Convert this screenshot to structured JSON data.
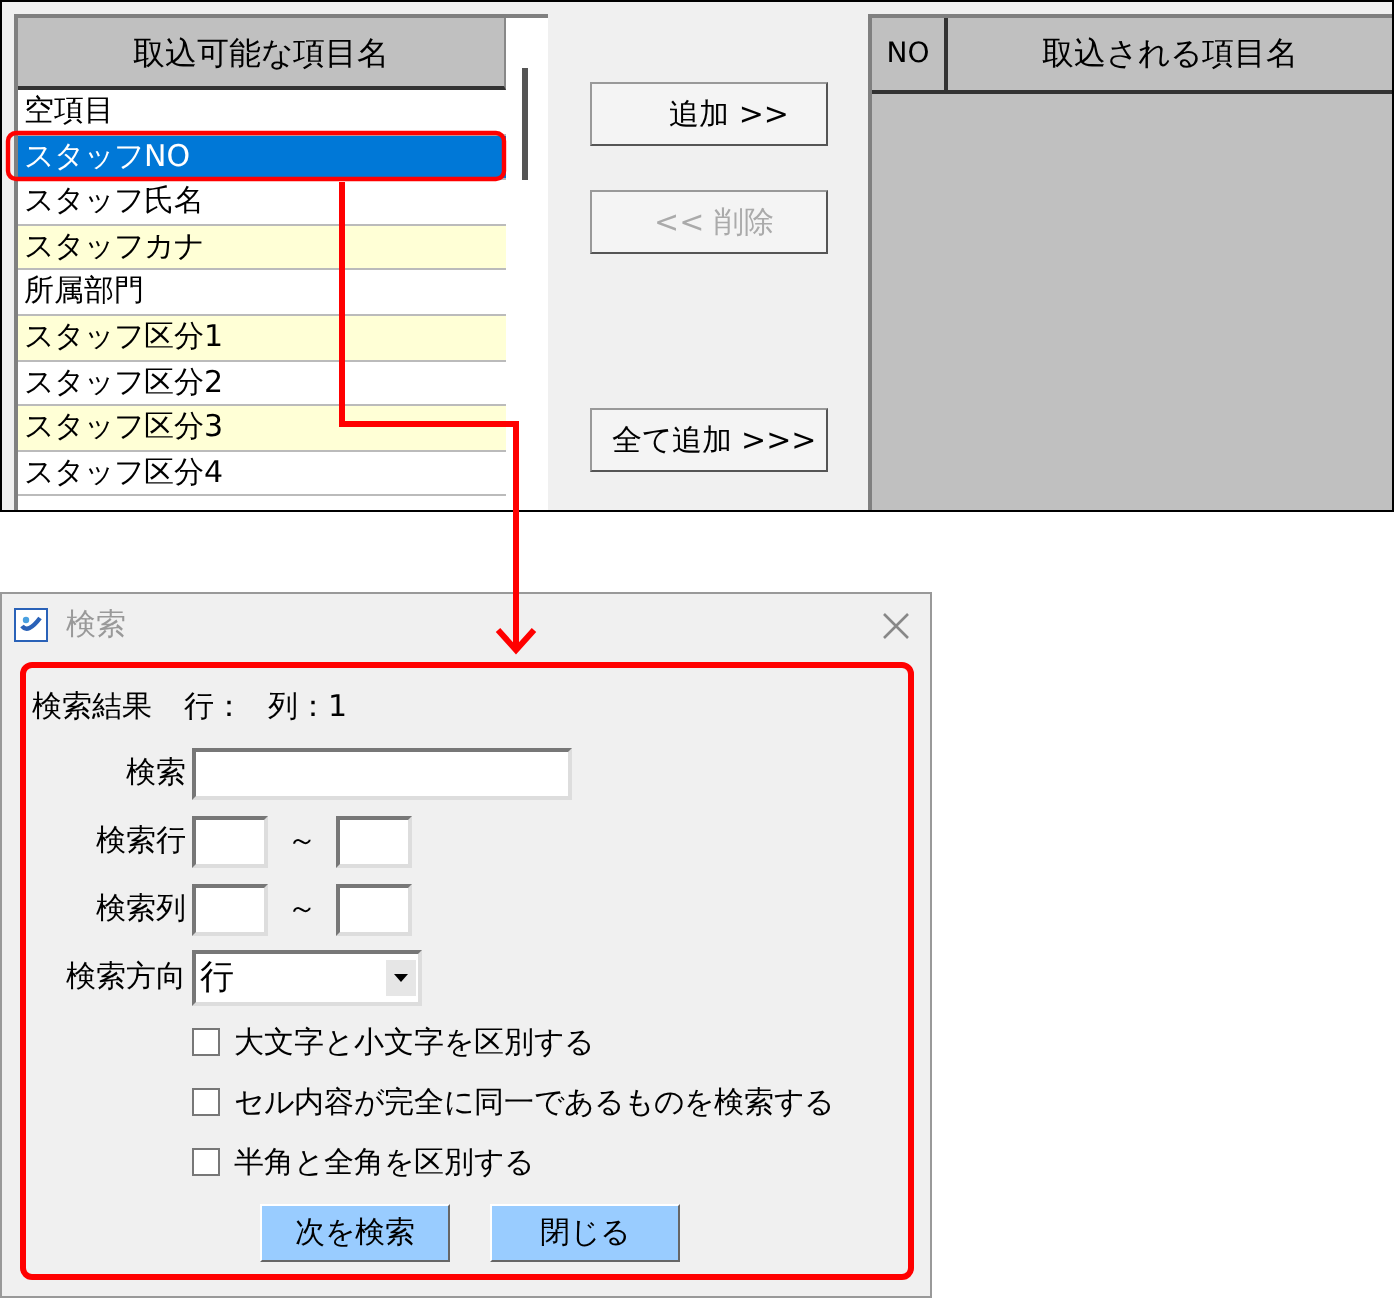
{
  "main": {
    "available_list": {
      "header": "取込可能な項目名",
      "items": [
        {
          "label": "空項目",
          "shaded": false,
          "selected": false
        },
        {
          "label": "スタッフNO",
          "shaded": false,
          "selected": true
        },
        {
          "label": "スタッフ氏名",
          "shaded": false,
          "selected": false
        },
        {
          "label": "スタッフカナ",
          "shaded": true,
          "selected": false
        },
        {
          "label": "所属部門",
          "shaded": false,
          "selected": false
        },
        {
          "label": "スタッフ区分1",
          "shaded": true,
          "selected": false
        },
        {
          "label": "スタッフ区分2",
          "shaded": false,
          "selected": false
        },
        {
          "label": "スタッフ区分3",
          "shaded": true,
          "selected": false
        },
        {
          "label": "スタッフ区分4",
          "shaded": false,
          "selected": false
        }
      ]
    },
    "buttons": [
      {
        "label": "追加 >>",
        "disabled": false
      },
      {
        "label": "<< 削除",
        "disabled": true
      },
      {
        "label": "全て追加 >>>",
        "disabled": false
      }
    ],
    "imported_table": {
      "columns": [
        "NO",
        "取込される項目名"
      ]
    }
  },
  "dialog": {
    "title": "検索",
    "result": {
      "label": "検索結果",
      "row": "行：",
      "column": "列：1"
    },
    "search_label": "検索",
    "ranges": [
      {
        "label": "検索行",
        "separator": "～"
      },
      {
        "label": "検索列",
        "separator": "～"
      }
    ],
    "direction": {
      "label": "検索方向",
      "value": "行"
    },
    "options": [
      {
        "label": "大文字と小文字を区別する",
        "checked": false
      },
      {
        "label": "セル内容が完全に同一であるものを検索する",
        "checked": false
      },
      {
        "label": "半角と全角を区別する",
        "checked": false
      }
    ],
    "buttons": [
      "次を検索",
      "閉じる"
    ]
  }
}
